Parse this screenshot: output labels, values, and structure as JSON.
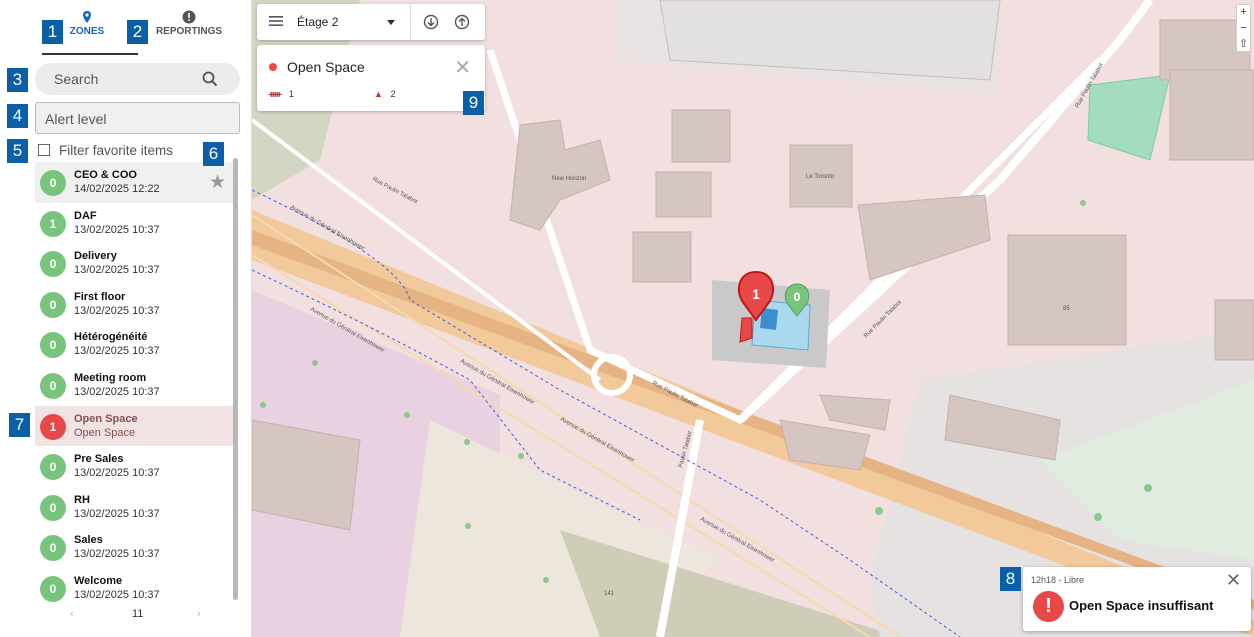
{
  "tabs": {
    "zones": "ZONES",
    "reportings": "REPORTINGS"
  },
  "badges": [
    "1",
    "2",
    "3",
    "4",
    "5",
    "6",
    "7",
    "8",
    "9"
  ],
  "search": {
    "placeholder": "Search"
  },
  "alert_level": {
    "placeholder": "Alert level"
  },
  "favorites": {
    "label": "Filter favorite items"
  },
  "zones": [
    {
      "count": "0",
      "name": "CEO & COO",
      "sub": "14/02/2025 12:22",
      "level": "ok"
    },
    {
      "count": "1",
      "name": "DAF",
      "sub": "13/02/2025 10:37",
      "level": "ok"
    },
    {
      "count": "0",
      "name": "Delivery",
      "sub": "13/02/2025 10:37",
      "level": "ok"
    },
    {
      "count": "0",
      "name": "First floor",
      "sub": "13/02/2025 10:37",
      "level": "ok"
    },
    {
      "count": "0",
      "name": "Hétérogénéité",
      "sub": "13/02/2025 10:37",
      "level": "ok"
    },
    {
      "count": "0",
      "name": "Meeting room",
      "sub": "13/02/2025 10:37",
      "level": "ok"
    },
    {
      "count": "1",
      "name": "Open Space",
      "sub": "Open Space",
      "level": "alert"
    },
    {
      "count": "0",
      "name": "Pre Sales",
      "sub": "13/02/2025 10:37",
      "level": "ok"
    },
    {
      "count": "0",
      "name": "RH",
      "sub": "13/02/2025 10:37",
      "level": "ok"
    },
    {
      "count": "0",
      "name": "Sales",
      "sub": "13/02/2025 10:37",
      "level": "ok"
    },
    {
      "count": "0",
      "name": "Welcome",
      "sub": "13/02/2025 10:37",
      "level": "ok"
    }
  ],
  "pager": {
    "prev": "‹",
    "page": "11",
    "next": "›"
  },
  "floor": {
    "label": "Étage 2"
  },
  "info": {
    "title": "Open Space",
    "people": "1",
    "warnings": "2"
  },
  "notification": {
    "time": "12h18 - Libre",
    "message": "Open Space insuffisant",
    "icon": "!"
  },
  "map_pins": {
    "alert": "1",
    "ok": "0"
  },
  "zoom": {
    "in": "+",
    "out": "−",
    "reset": "⇧"
  },
  "map_labels": {
    "road_eisenhower_1": "Avenue du Général Eisenhower",
    "road_eisenhower_2": "Avenue du Général Eisenhower",
    "road_eisenhower_3": "Avenue du Général Eisenhower",
    "road_eisenhower_4": "Avenue du Général Eisenhower",
    "road_eisenhower_5": "Avenue du Général Eisenhower",
    "road_talabot_1": "Rue Paulin Talabot",
    "road_talabot_2": "Rue Paulin Talabot",
    "road_talabot_3": "Rue Paulin Talabot",
    "road_talabot_4": "Rue Paulin Talabot",
    "road_talabot_5": "Paulin Talabot",
    "new_horizon": "New Horizon",
    "le_toronto": "Le Toronto",
    "label_85": "85",
    "label_141": "141"
  },
  "colors": {
    "accent": "#1565c0",
    "badge": "#0a5fa8",
    "ok": "#78c47d",
    "alert": "#e94848"
  }
}
